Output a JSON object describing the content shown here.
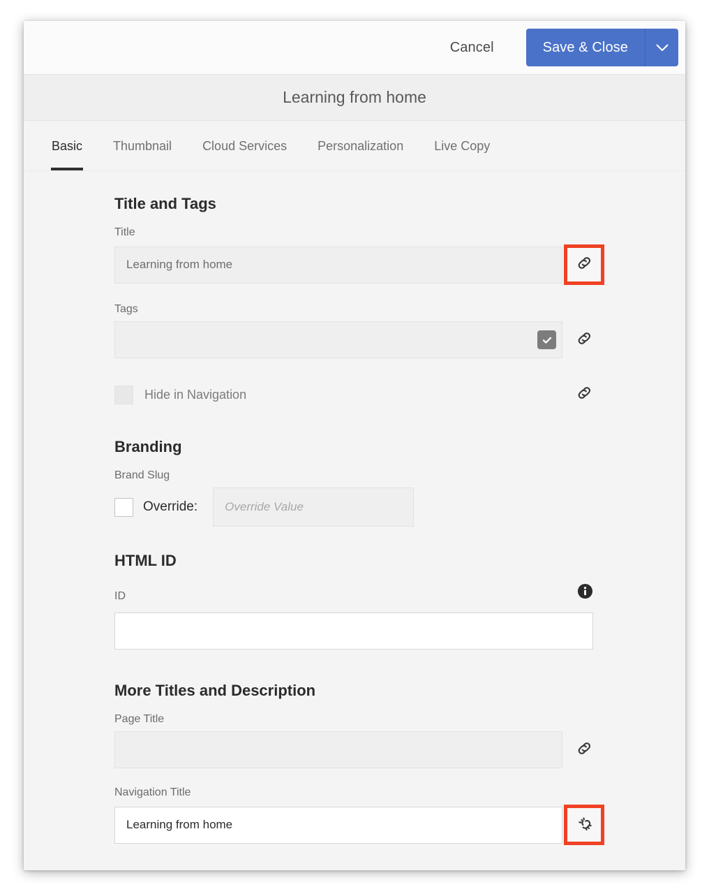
{
  "toolbar": {
    "cancel_label": "Cancel",
    "save_label": "Save & Close",
    "dropdown_icon": "chevron-down-icon",
    "accent_color": "#4a72c8"
  },
  "dialog": {
    "title": "Learning from home"
  },
  "tabs": [
    {
      "label": "Basic",
      "active": true
    },
    {
      "label": "Thumbnail",
      "active": false
    },
    {
      "label": "Cloud Services",
      "active": false
    },
    {
      "label": "Personalization",
      "active": false
    },
    {
      "label": "Live Copy",
      "active": false
    }
  ],
  "sections": {
    "title_and_tags": {
      "heading": "Title and Tags",
      "title": {
        "label": "Title",
        "value": "Learning from home",
        "placeholder": "",
        "link_icon": "link-icon",
        "highlighted": true
      },
      "tags": {
        "label": "Tags",
        "value": "",
        "placeholder": "",
        "checkbox_checked": true,
        "link_icon": "link-icon"
      },
      "hide_in_navigation": {
        "label": "Hide in Navigation",
        "checked": false,
        "link_icon": "link-icon"
      }
    },
    "branding": {
      "heading": "Branding",
      "brand_slug": {
        "label": "Brand Slug",
        "override_label": "Override:",
        "override_checked": false,
        "value": "",
        "placeholder": "Override Value"
      }
    },
    "html_id": {
      "heading": "HTML ID",
      "id": {
        "label": "ID",
        "value": "",
        "placeholder": "",
        "info_icon": "info-icon"
      }
    },
    "more_titles": {
      "heading": "More Titles and Description",
      "page_title": {
        "label": "Page Title",
        "value": "",
        "placeholder": "",
        "link_icon": "link-icon"
      },
      "navigation_title": {
        "label": "Navigation Title",
        "value": "Learning from home",
        "placeholder": "",
        "link_icon": "broken-link-icon",
        "highlighted": true
      }
    }
  },
  "highlight_color": "#ef4123"
}
